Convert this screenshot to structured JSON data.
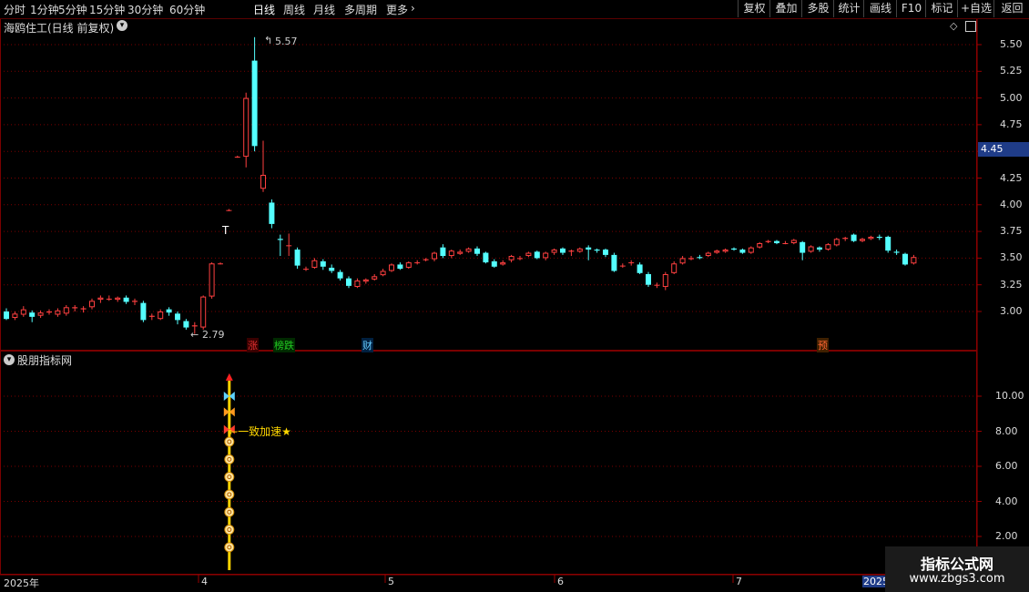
{
  "toolbar": {
    "periods": [
      "分时",
      "1分钟",
      "5分钟",
      "15分钟",
      "30分钟",
      "60分钟",
      "日线",
      "周线",
      "月线",
      "多周期",
      "更多"
    ],
    "active_period": "日线",
    "right_buttons": [
      "复权",
      "叠加",
      "多股",
      "统计",
      "画线",
      "F10",
      "标记",
      "+自选",
      "返回"
    ]
  },
  "main_panel": {
    "title": "海鸥住工(日线 前复权)",
    "price_axis": [
      "5.50",
      "5.25",
      "5.00",
      "4.75",
      "4.50",
      "4.25",
      "4.00",
      "3.75",
      "3.50",
      "3.25",
      "3.00"
    ],
    "current_price": "4.45",
    "high_label": "5.57",
    "low_label": "2.79",
    "markers": [
      {
        "text": "涨",
        "color": "#e03030"
      },
      {
        "text": "榜跌",
        "color": "#22c922"
      },
      {
        "text": "财",
        "color": "#66ccff"
      },
      {
        "text": "预",
        "color": "#ff6633"
      }
    ]
  },
  "indicator_panel": {
    "title": "股朋指标网",
    "axis": [
      "10.00",
      "8.00",
      "6.00",
      "4.00",
      "2.00"
    ],
    "signal_text": "一致加速★"
  },
  "date_axis": [
    "2025年",
    "4",
    "5",
    "6",
    "7",
    "2025"
  ],
  "watermark": {
    "title": "指标公式网",
    "url": "www.zbgs3.com"
  },
  "colors": {
    "up": "#ff4040",
    "down": "#54ffff",
    "grid": "#7a0000",
    "axis_text": "#dcdcdc"
  },
  "chart_data": {
    "type": "candlestick",
    "ylim": [
      2.7,
      5.65
    ],
    "candles": [
      [
        3.0,
        2.93,
        3.03,
        2.92
      ],
      [
        2.94,
        2.98,
        3.0,
        2.92
      ],
      [
        2.97,
        3.02,
        3.05,
        2.95
      ],
      [
        2.99,
        2.95,
        3.01,
        2.9
      ],
      [
        2.96,
        2.99,
        3.01,
        2.94
      ],
      [
        2.99,
        3.0,
        3.02,
        2.97
      ],
      [
        2.97,
        3.01,
        3.03,
        2.95
      ],
      [
        2.98,
        3.04,
        3.06,
        2.96
      ],
      [
        3.03,
        3.04,
        3.06,
        3.0
      ],
      [
        3.02,
        3.03,
        3.05,
        2.99
      ],
      [
        3.04,
        3.1,
        3.12,
        3.02
      ],
      [
        3.11,
        3.13,
        3.15,
        3.08
      ],
      [
        3.12,
        3.12,
        3.15,
        3.1
      ],
      [
        3.11,
        3.13,
        3.14,
        3.09
      ],
      [
        3.13,
        3.09,
        3.15,
        3.07
      ],
      [
        3.09,
        3.1,
        3.12,
        3.06
      ],
      [
        3.08,
        2.92,
        3.1,
        2.9
      ],
      [
        2.95,
        2.96,
        2.98,
        2.92
      ],
      [
        2.93,
        3.0,
        3.02,
        2.92
      ],
      [
        3.02,
        2.99,
        3.04,
        2.96
      ],
      [
        2.98,
        2.92,
        3.0,
        2.88
      ],
      [
        2.91,
        2.85,
        2.93,
        2.83
      ],
      [
        2.86,
        2.87,
        2.9,
        2.79
      ],
      [
        2.85,
        3.14,
        3.15,
        2.83
      ],
      [
        3.14,
        3.45,
        3.46,
        3.12
      ],
      [
        3.45,
        3.45,
        3.46,
        3.44
      ],
      [
        3.95,
        3.95,
        3.96,
        3.94
      ],
      [
        4.45,
        4.45,
        4.46,
        4.44
      ],
      [
        4.45,
        5.0,
        5.05,
        4.35
      ],
      [
        5.35,
        4.55,
        5.57,
        4.5
      ],
      [
        4.15,
        4.28,
        4.6,
        4.12
      ],
      [
        4.02,
        3.82,
        4.05,
        3.78
      ],
      [
        3.68,
        3.67,
        3.72,
        3.52
      ],
      [
        3.62,
        3.62,
        3.73,
        3.52
      ],
      [
        3.58,
        3.43,
        3.6,
        3.4
      ],
      [
        3.4,
        3.4,
        3.42,
        3.38
      ],
      [
        3.41,
        3.48,
        3.5,
        3.4
      ],
      [
        3.47,
        3.42,
        3.49,
        3.39
      ],
      [
        3.41,
        3.38,
        3.44,
        3.36
      ],
      [
        3.37,
        3.31,
        3.39,
        3.29
      ],
      [
        3.31,
        3.24,
        3.33,
        3.22
      ],
      [
        3.23,
        3.29,
        3.31,
        3.22
      ],
      [
        3.28,
        3.3,
        3.31,
        3.26
      ],
      [
        3.3,
        3.33,
        3.35,
        3.29
      ],
      [
        3.34,
        3.38,
        3.4,
        3.33
      ],
      [
        3.38,
        3.44,
        3.45,
        3.37
      ],
      [
        3.44,
        3.4,
        3.46,
        3.39
      ],
      [
        3.41,
        3.46,
        3.47,
        3.4
      ],
      [
        3.46,
        3.46,
        3.48,
        3.44
      ],
      [
        3.48,
        3.49,
        3.5,
        3.47
      ],
      [
        3.49,
        3.55,
        3.56,
        3.47
      ],
      [
        3.6,
        3.52,
        3.63,
        3.5
      ],
      [
        3.52,
        3.57,
        3.58,
        3.5
      ],
      [
        3.54,
        3.56,
        3.58,
        3.53
      ],
      [
        3.56,
        3.59,
        3.6,
        3.55
      ],
      [
        3.59,
        3.54,
        3.61,
        3.52
      ],
      [
        3.55,
        3.46,
        3.56,
        3.45
      ],
      [
        3.47,
        3.42,
        3.49,
        3.41
      ],
      [
        3.44,
        3.46,
        3.48,
        3.43
      ],
      [
        3.48,
        3.52,
        3.53,
        3.46
      ],
      [
        3.5,
        3.5,
        3.52,
        3.48
      ],
      [
        3.52,
        3.55,
        3.56,
        3.51
      ],
      [
        3.56,
        3.5,
        3.57,
        3.49
      ],
      [
        3.5,
        3.55,
        3.56,
        3.48
      ],
      [
        3.55,
        3.58,
        3.59,
        3.53
      ],
      [
        3.59,
        3.55,
        3.6,
        3.53
      ],
      [
        3.56,
        3.57,
        3.58,
        3.52
      ],
      [
        3.56,
        3.59,
        3.6,
        3.55
      ],
      [
        3.6,
        3.58,
        3.62,
        3.48
      ],
      [
        3.58,
        3.57,
        3.59,
        3.55
      ],
      [
        3.58,
        3.53,
        3.59,
        3.51
      ],
      [
        3.53,
        3.38,
        3.55,
        3.37
      ],
      [
        3.43,
        3.43,
        3.45,
        3.41
      ],
      [
        3.46,
        3.46,
        3.48,
        3.43
      ],
      [
        3.44,
        3.36,
        3.46,
        3.35
      ],
      [
        3.35,
        3.25,
        3.37,
        3.23
      ],
      [
        3.25,
        3.25,
        3.27,
        3.22
      ],
      [
        3.23,
        3.35,
        3.37,
        3.2
      ],
      [
        3.36,
        3.45,
        3.47,
        3.35
      ],
      [
        3.45,
        3.5,
        3.52,
        3.44
      ],
      [
        3.49,
        3.5,
        3.52,
        3.48
      ],
      [
        3.51,
        3.5,
        3.53,
        3.49
      ],
      [
        3.52,
        3.55,
        3.56,
        3.51
      ],
      [
        3.55,
        3.57,
        3.58,
        3.54
      ],
      [
        3.56,
        3.58,
        3.59,
        3.55
      ],
      [
        3.59,
        3.58,
        3.6,
        3.57
      ],
      [
        3.58,
        3.55,
        3.59,
        3.54
      ],
      [
        3.55,
        3.6,
        3.61,
        3.54
      ],
      [
        3.6,
        3.64,
        3.65,
        3.59
      ],
      [
        3.65,
        3.66,
        3.67,
        3.64
      ],
      [
        3.66,
        3.64,
        3.67,
        3.63
      ],
      [
        3.64,
        3.64,
        3.66,
        3.63
      ],
      [
        3.64,
        3.67,
        3.68,
        3.63
      ],
      [
        3.65,
        3.55,
        3.66,
        3.48
      ],
      [
        3.56,
        3.61,
        3.62,
        3.55
      ],
      [
        3.6,
        3.58,
        3.61,
        3.56
      ],
      [
        3.58,
        3.63,
        3.64,
        3.57
      ],
      [
        3.62,
        3.68,
        3.69,
        3.61
      ],
      [
        3.68,
        3.69,
        3.7,
        3.66
      ],
      [
        3.72,
        3.66,
        3.73,
        3.65
      ],
      [
        3.66,
        3.68,
        3.69,
        3.65
      ],
      [
        3.68,
        3.7,
        3.71,
        3.67
      ],
      [
        3.7,
        3.69,
        3.72,
        3.67
      ],
      [
        3.7,
        3.57,
        3.71,
        3.55
      ],
      [
        3.56,
        3.55,
        3.58,
        3.53
      ],
      [
        3.54,
        3.44,
        3.55,
        3.43
      ],
      [
        3.45,
        3.51,
        3.53,
        3.44
      ]
    ],
    "indicator_bar": {
      "x_index": 22,
      "values_top": 11.2,
      "axis_ylim": [
        1.0,
        11.8
      ]
    }
  }
}
